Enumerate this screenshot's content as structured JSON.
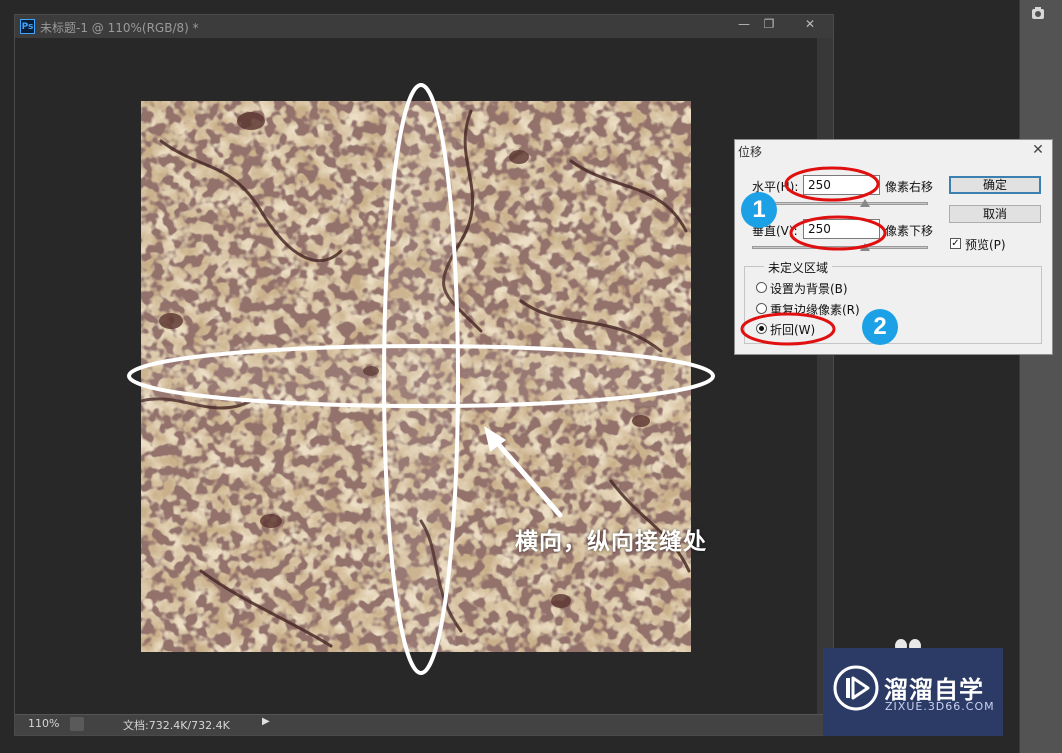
{
  "document": {
    "title": "未标题-1 @ 110%(RGB/8) *",
    "app_badge": "Ps",
    "window_buttons": {
      "minimize": "—",
      "restore": "❐",
      "close": "✕"
    }
  },
  "status_bar": {
    "zoom": "110%",
    "doc_size": "文档:732.4K/732.4K",
    "menu_arrow": "▶"
  },
  "offset_dialog": {
    "title": "位移",
    "close": "✕",
    "horizontal_label": "水平(H):",
    "horizontal_value": "250",
    "horizontal_unit": "像素右移",
    "vertical_label": "垂直(V):",
    "vertical_value": "250",
    "vertical_unit": "像素下移",
    "ok_label": "确定",
    "cancel_label": "取消",
    "preview_label": "预览(P)",
    "preview_checked": true,
    "undefined_area_title": "未定义区域",
    "options": [
      {
        "label": "设置为背景(B)",
        "selected": false
      },
      {
        "label": "重复边缘像素(R)",
        "selected": false
      },
      {
        "label": "折回(W)",
        "selected": true
      }
    ]
  },
  "annotations": {
    "badge_1": "1",
    "badge_2": "2",
    "caption": "横向，纵向接缝处",
    "highlight_color": "#e01010",
    "badge_color": "#1da1e6"
  },
  "watermark": {
    "title": "溜溜自学",
    "url": "ZIXUE.3D66.COM"
  }
}
